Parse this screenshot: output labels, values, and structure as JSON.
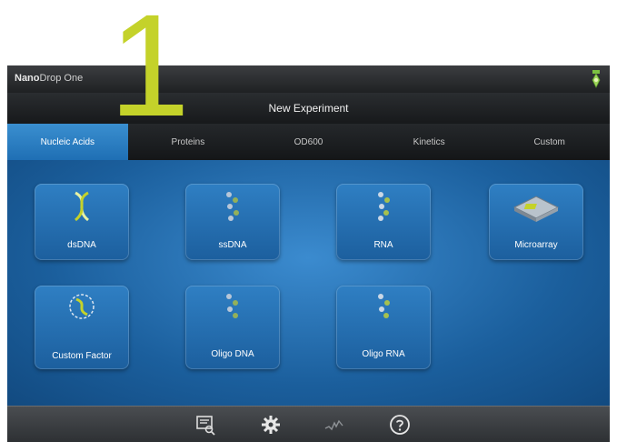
{
  "step_number": "1",
  "app": {
    "brand_bold": "Nano",
    "brand_rest": "Drop One"
  },
  "screen_title": "New Experiment",
  "tabs": [
    {
      "label": "Nucleic Acids",
      "active": true
    },
    {
      "label": "Proteins",
      "active": false
    },
    {
      "label": "OD600",
      "active": false
    },
    {
      "label": "Kinetics",
      "active": false
    },
    {
      "label": "Custom",
      "active": false
    }
  ],
  "tiles": [
    {
      "label": "dsDNA",
      "icon": "dsdna-icon"
    },
    {
      "label": "ssDNA",
      "icon": "ssdna-icon"
    },
    {
      "label": "RNA",
      "icon": "rna-icon"
    },
    {
      "label": "Microarray",
      "icon": "microarray-icon"
    },
    {
      "label": "Custom Factor",
      "icon": "custom-factor-icon"
    },
    {
      "label": "Oligo DNA",
      "icon": "oligo-dna-icon"
    },
    {
      "label": "Oligo RNA",
      "icon": "oligo-rna-icon"
    }
  ],
  "bottom_icons": [
    "data-viewer-icon",
    "settings-gear-icon",
    "signal-icon",
    "help-icon"
  ],
  "colors": {
    "accent_green": "#c4d22a",
    "tab_active": "#2a86cc",
    "content_blue": "#1f6aa8"
  }
}
